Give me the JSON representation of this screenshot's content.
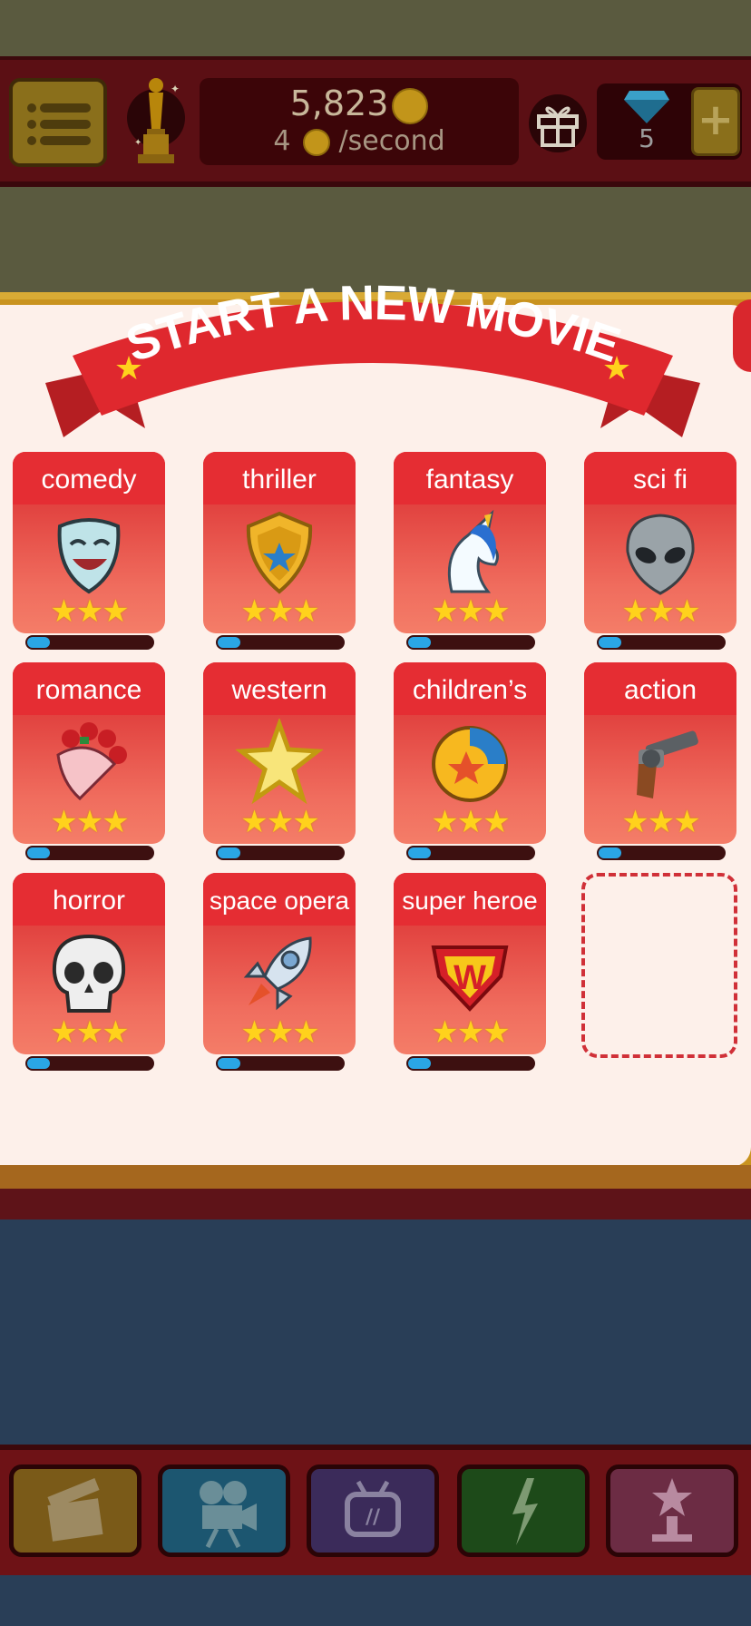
{
  "header": {
    "coins": "5,823",
    "rate_value": "4",
    "rate_suffix": "/second",
    "gems": "5",
    "plus_label": "+"
  },
  "banner": {
    "title": "START A NEW MOVIE"
  },
  "genres": [
    {
      "label": "comedy",
      "icon": "comedy-mask-icon",
      "stars": 3,
      "progress": 0.18
    },
    {
      "label": "thriller",
      "icon": "police-badge-icon",
      "stars": 3,
      "progress": 0.18
    },
    {
      "label": "fantasy",
      "icon": "unicorn-icon",
      "stars": 3,
      "progress": 0.18
    },
    {
      "label": "sci fi",
      "icon": "alien-icon",
      "stars": 3,
      "progress": 0.18
    },
    {
      "label": "romance",
      "icon": "flower-bouquet-icon",
      "stars": 3,
      "progress": 0.18
    },
    {
      "label": "western",
      "icon": "sheriff-star-icon",
      "stars": 3,
      "progress": 0.18
    },
    {
      "label": "children’s",
      "icon": "ball-icon",
      "stars": 3,
      "progress": 0.18
    },
    {
      "label": "action",
      "icon": "revolver-icon",
      "stars": 3,
      "progress": 0.18
    },
    {
      "label": "horror",
      "icon": "skull-icon",
      "stars": 3,
      "progress": 0.18
    },
    {
      "label": "space opera",
      "icon": "rocket-icon",
      "stars": 3,
      "progress": 0.18
    },
    {
      "label": "super heroe",
      "icon": "superhero-emblem-icon",
      "stars": 3,
      "progress": 0.18
    }
  ],
  "star_glyphs": "★★★",
  "nav": [
    {
      "name": "clapperboard-icon",
      "color": "#7a5a18"
    },
    {
      "name": "movie-camera-icon",
      "color": "#1c5670"
    },
    {
      "name": "tv-icon",
      "color": "#3b2b5a"
    },
    {
      "name": "lightning-icon",
      "color": "#1d4a19"
    },
    {
      "name": "award-trophy-icon",
      "color": "#6c2c44"
    }
  ],
  "colors": {
    "accent_red": "#e52d33",
    "progress_blue": "#2aa6e5",
    "star_yellow": "#ffd21c"
  }
}
